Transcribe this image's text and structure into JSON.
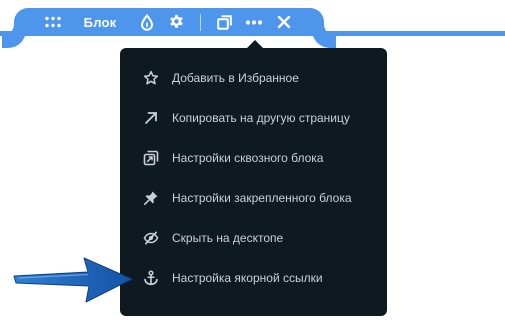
{
  "toolbar": {
    "block_label": "Блок",
    "icons": [
      "grid-dots-icon",
      "drop-icon",
      "gear-icon",
      "duplicate-icon",
      "more-dots-icon",
      "close-icon"
    ]
  },
  "menu": {
    "items": [
      {
        "label": "Добавить в Избранное",
        "icon": "star-icon"
      },
      {
        "label": "Копировать на другую страницу",
        "icon": "arrow-up-right-icon"
      },
      {
        "label": "Настройки сквозного блока",
        "icon": "through-block-icon"
      },
      {
        "label": "Настройки закрепленного блока",
        "icon": "pin-icon"
      },
      {
        "label": "Скрыть на десктопе",
        "icon": "eye-hidden-icon"
      },
      {
        "label": "Настройка якорной ссылки",
        "icon": "anchor-icon"
      }
    ]
  },
  "colors": {
    "accent": "#4e95ec",
    "menu_bg": "#0f1a20",
    "menu_text": "#c8d0d6",
    "pointer_arrow": "#1c63b4"
  }
}
